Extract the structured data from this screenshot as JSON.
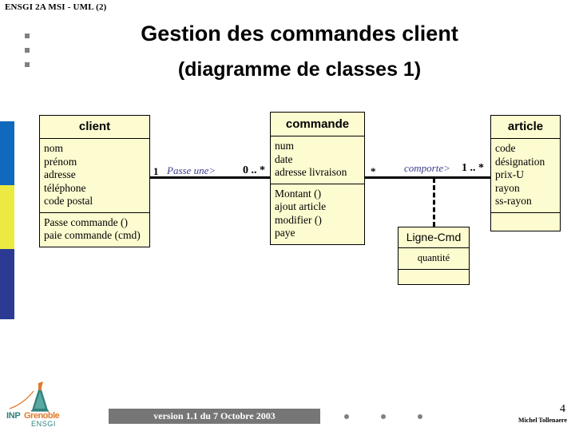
{
  "header": {
    "course_label": "ENSGI 2A MSI - UML (2)"
  },
  "title": {
    "main": "Gestion des commandes client",
    "sub": "(diagramme de classes 1)"
  },
  "diagram": {
    "classes": [
      {
        "id": "client",
        "name": "client",
        "attributes": [
          "nom",
          "prénom",
          "adresse",
          "téléphone",
          "code postal"
        ],
        "operations": [
          "Passe commande ()",
          "paie commande (cmd)"
        ]
      },
      {
        "id": "commande",
        "name": "commande",
        "attributes": [
          "num",
          "date",
          "adresse livraison"
        ],
        "operations": [
          "Montant ()",
          "ajout article",
          "modifier ()",
          "paye"
        ]
      },
      {
        "id": "article",
        "name": "article",
        "attributes": [
          "code",
          "désignation",
          "prix-U",
          "rayon",
          "ss-rayon"
        ],
        "operations": []
      },
      {
        "id": "ligne-cmd",
        "name": "Ligne-Cmd",
        "attributes": [
          "quantité"
        ],
        "operations": []
      }
    ],
    "associations": [
      {
        "id": "client-commande",
        "label": "Passe une>",
        "source_multiplicity": "1",
        "target_multiplicity": "0 .. *"
      },
      {
        "id": "commande-article",
        "label": "comporte>",
        "source_multiplicity": "*",
        "target_multiplicity": "1 .. *"
      }
    ]
  },
  "footer": {
    "version": "version 1.1 du 7 Octobre 2003",
    "page_number": "4",
    "author": "Michel Tollenaere",
    "logo": {
      "inp": "INP",
      "grenoble": "Grenoble",
      "ensgi": "ENSGI"
    }
  },
  "colors": {
    "bar_blue": "#1069bd",
    "bar_yellow": "#ecea42",
    "bar_navy": "#2b3b94",
    "class_fill": "#fdfbd0",
    "assoc_label": "#3b3b8f",
    "version_bar": "#767676"
  }
}
